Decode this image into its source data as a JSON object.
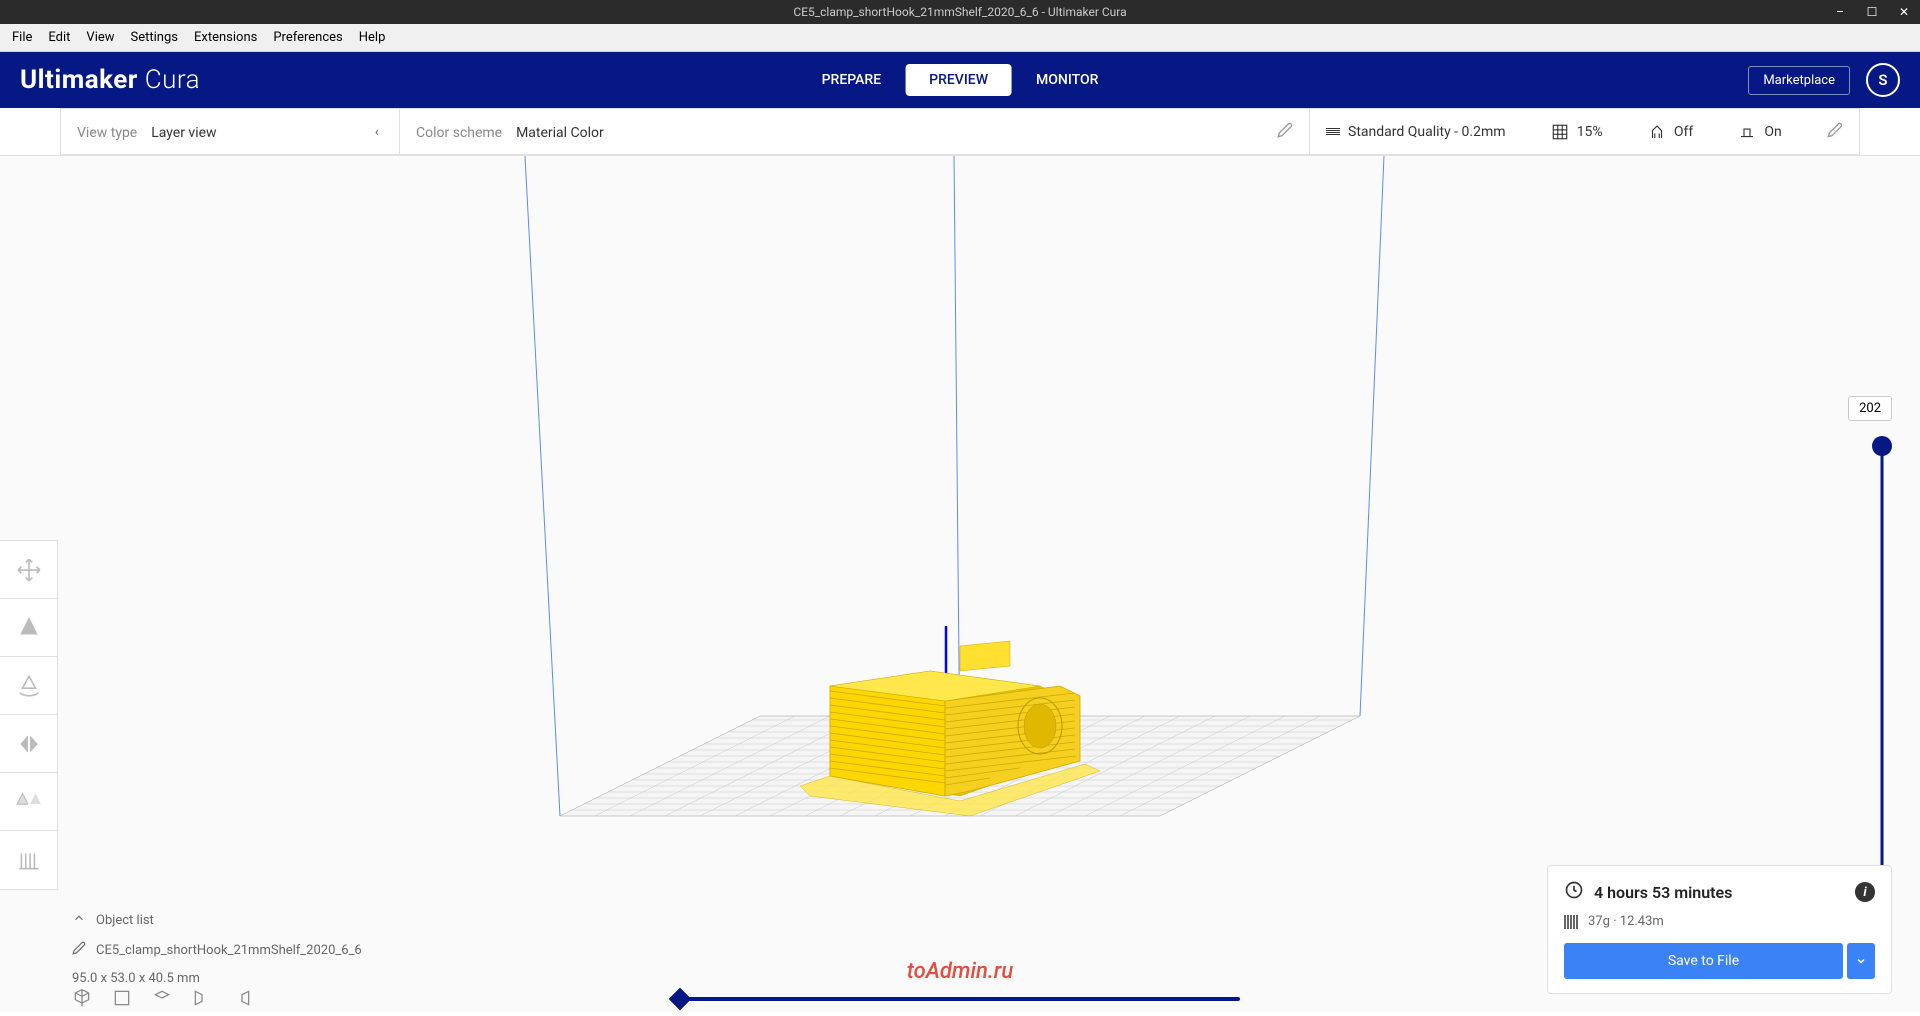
{
  "titlebar": {
    "title": "CE5_clamp_shortHook_21mmShelf_2020_6_6 - Ultimaker Cura"
  },
  "menubar": {
    "items": [
      "File",
      "Edit",
      "View",
      "Settings",
      "Extensions",
      "Preferences",
      "Help"
    ]
  },
  "header": {
    "logo_bold": "Ultimaker",
    "logo_light": "Cura",
    "tabs": [
      {
        "label": "PREPARE",
        "active": false
      },
      {
        "label": "PREVIEW",
        "active": true
      },
      {
        "label": "MONITOR",
        "active": false
      }
    ],
    "marketplace": "Marketplace",
    "profile_initial": "S"
  },
  "settings_bar": {
    "view_type_label": "View type",
    "view_type_value": "Layer view",
    "color_scheme_label": "Color scheme",
    "color_scheme_value": "Material Color",
    "quality": "Standard Quality - 0.2mm",
    "infill": "15%",
    "support": "Off",
    "adhesion": "On"
  },
  "layer_slider": {
    "current": "202"
  },
  "object_panel": {
    "list_label": "Object list",
    "object_name": "CE5_clamp_shortHook_21mmShelf_2020_6_6",
    "dimensions": "95.0 x 53.0 x 40.5 mm"
  },
  "print_panel": {
    "time": "4 hours 53 minutes",
    "material": "37g · 12.43m",
    "save_label": "Save to File"
  },
  "watermark": "toAdmin.ru",
  "colors": {
    "primary": "#061884",
    "accent_blue": "#3b82f6",
    "model_yellow": "#ffd700"
  }
}
